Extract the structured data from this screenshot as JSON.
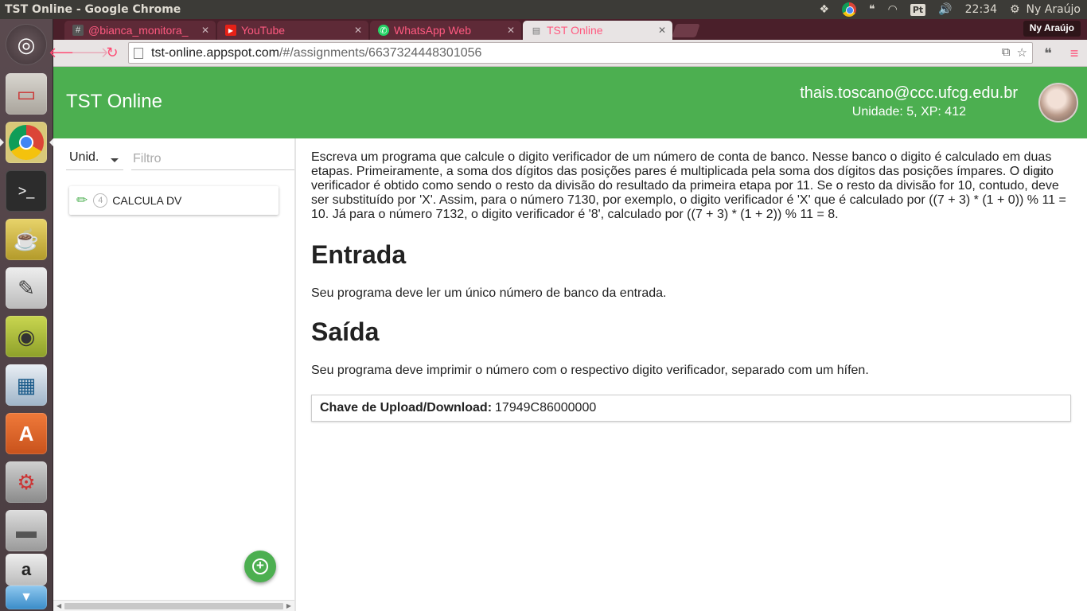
{
  "system_panel": {
    "window_title": "TST Online - Google Chrome",
    "clock": "22:34",
    "user": "Ny Araújo",
    "keyboard_layout": "Pt",
    "icons": [
      "dropbox-icon",
      "chrome-icon",
      "chat-icon",
      "wifi-icon",
      "keyboard-icon",
      "volume-icon",
      "gear-icon"
    ]
  },
  "launcher": {
    "items": [
      "ubuntu-dash-icon",
      "files-icon",
      "chrome-icon",
      "terminal-icon",
      "teapot-icon",
      "text-editor-icon",
      "rhythmbox-icon",
      "libreoffice-impress-icon",
      "software-center-icon",
      "system-settings-icon",
      "drive-icon",
      "amazon-icon",
      "trash-icon"
    ]
  },
  "browser": {
    "profile_name": "Ny Araújo",
    "tabs": [
      {
        "label": "@bianca_monitora_",
        "favicon": "#"
      },
      {
        "label": "YouTube",
        "favicon": "▶"
      },
      {
        "label": "WhatsApp Web",
        "favicon": "✆"
      },
      {
        "label": "TST Online",
        "favicon": "▤"
      }
    ],
    "url_host": "tst-online.appspot.com",
    "url_path": "/#/assignments/6637324448301056"
  },
  "app": {
    "title": "TST Online",
    "user_email": "thais.toscano@ccc.ufcg.edu.br",
    "user_stats": "Unidade: 5, XP: 412",
    "accent_color": "#4caf50"
  },
  "sidebar": {
    "unit_select": "Unid.",
    "filter_placeholder": "Filtro",
    "assignments": [
      {
        "count": "4",
        "name": "CALCULA DV"
      }
    ]
  },
  "assignment": {
    "description": "Escreva um programa que calcule o digito verificador de um número de conta de banco. Nesse banco o digito é calculado em duas etapas. Primeiramente, a soma dos dígitos das posições pares é multiplicada pela soma dos dígitos das posições ímpares. O digito verificador é obtido como sendo o resto da divisão do resultado da primeira etapa por 11. Se o resto da divisão for 10, contudo, deve ser substituído por 'X'. Assim, para o número 7130, por exemplo, o digito verificador é 'X' que é calculado por ((7 + 3) * (1 + 0)) % 11 = 10. Já para o número 7132, o digito verificador é '8', calculado por ((7 + 3) * (1 + 2)) % 11 = 8.",
    "input_heading": "Entrada",
    "input_text": "Seu programa deve ler um único número de banco da entrada.",
    "output_heading": "Saída",
    "output_text": "Seu programa deve imprimir o número com o respectivo digito verificador, separado com um hífen.",
    "key_label": "Chave de Upload/Download:",
    "key_value": "17949C86000000"
  }
}
